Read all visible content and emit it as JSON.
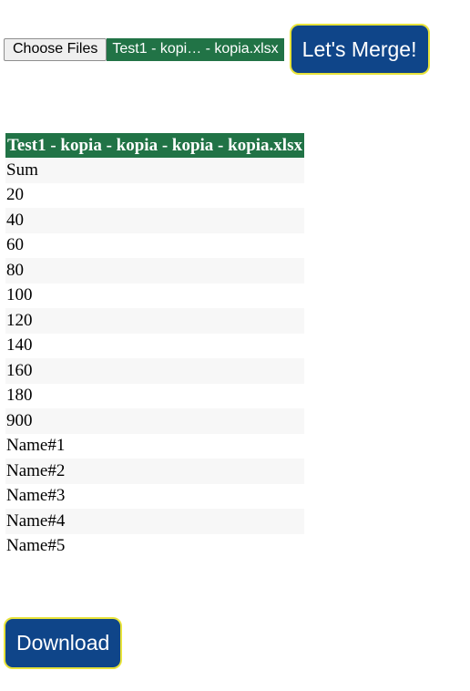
{
  "upload": {
    "choose_label": "Choose Files",
    "file_name": "Test1 - kopi… - kopia.xlsx",
    "merge_label": "Let's Merge!"
  },
  "table": {
    "header": "Test1 - kopia - kopia - kopia - kopia.xlsx",
    "rows": [
      "Sum",
      "20",
      "40",
      "60",
      "80",
      "100",
      "120",
      "140",
      "160",
      "180",
      "900",
      "Name#1",
      "Name#2",
      "Name#3",
      "Name#4",
      "Name#5"
    ]
  },
  "download": {
    "label": "Download"
  },
  "colors": {
    "excel_green": "#217346",
    "button_blue": "#0f4589",
    "button_border": "#e8e33a"
  }
}
